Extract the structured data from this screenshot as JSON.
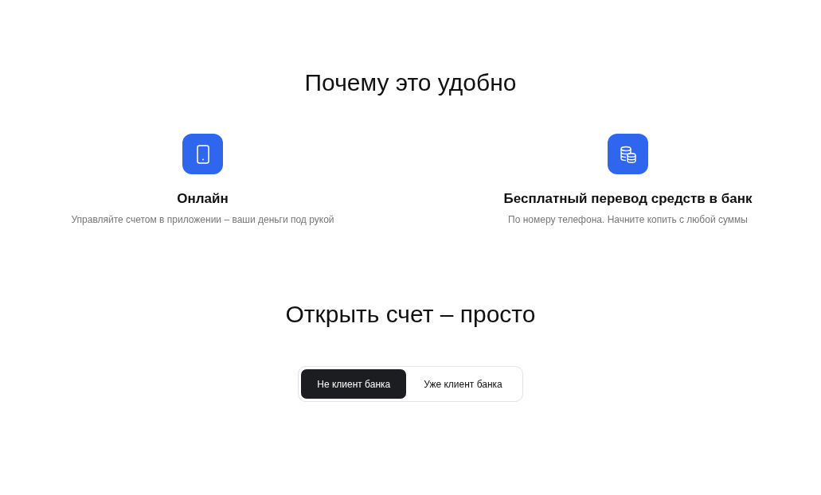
{
  "benefits_title": "Почему это удобно",
  "benefits": [
    {
      "kind": "phone",
      "title": "Онлайн",
      "description": "Управляйте счетом в приложении – ваши деньги под рукой"
    },
    {
      "kind": "coins",
      "title": "Бесплатный перевод средств в банк",
      "description": "По номеру телефона. Начните копить с любой суммы"
    }
  ],
  "open_title": "Открыть счет – просто",
  "tabs": [
    {
      "label": "Не клиент банка",
      "selected": true
    },
    {
      "label": "Уже клиент банка",
      "selected": false
    }
  ]
}
